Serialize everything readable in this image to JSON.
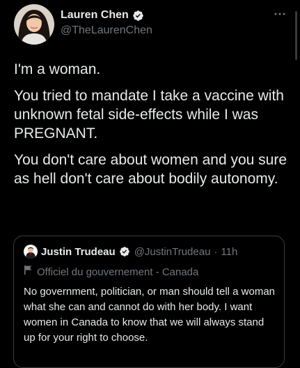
{
  "author": {
    "name": "Lauren Chen",
    "handle": "@TheLaurenChen"
  },
  "tweet": {
    "paragraphs": [
      "I'm a woman.",
      "You tried to mandate I take a vaccine with unknown fetal side-effects while I was PREGNANT.",
      "You don't care about women and you sure as hell don't care about bodily autonomy."
    ]
  },
  "quote": {
    "author_name": "Justin Trudeau",
    "handle": "@JustinTrudeau",
    "separator": "·",
    "time": "11h",
    "label": "Officiel du gouvernement - Canada",
    "text": "No government, politician, or man should tell a woman what she can and cannot do with her body. I want women in Canada to know that we will always stand up for your right to choose."
  },
  "icons": {
    "verified": "verified-badge-icon",
    "more": "more-icon",
    "government": "flag-icon"
  },
  "colors": {
    "background": "#000000",
    "text": "#e7e9ea",
    "secondary": "#71767b",
    "verified": "#1d9bf0",
    "border": "#3a3d41"
  }
}
